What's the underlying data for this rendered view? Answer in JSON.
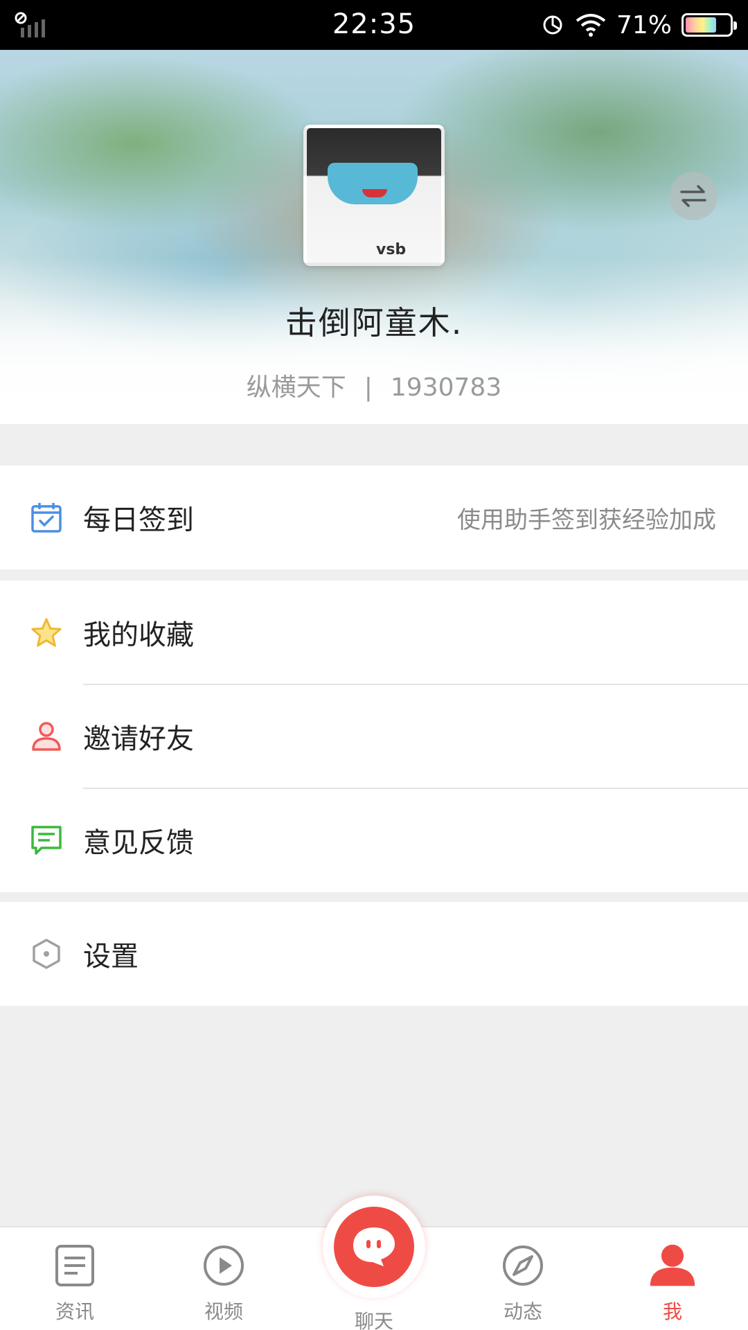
{
  "status_bar": {
    "time": "22:35",
    "battery_percent": "71%",
    "battery_level": 0.71
  },
  "profile": {
    "avatar_tag": "vsb",
    "username": "击倒阿童木.",
    "server": "纵横天下",
    "separator": "|",
    "user_id": "1930783"
  },
  "menu": {
    "checkin": {
      "label": "每日签到",
      "hint": "使用助手签到获经验加成",
      "icon": "calendar-check-icon",
      "color": "#4a90e2"
    },
    "favorites": {
      "label": "我的收藏",
      "icon": "star-icon",
      "color": "#f5c242"
    },
    "invite": {
      "label": "邀请好友",
      "icon": "person-icon",
      "color": "#ef5b57"
    },
    "feedback": {
      "label": "意见反馈",
      "icon": "message-icon",
      "color": "#3cb93c"
    },
    "settings": {
      "label": "设置",
      "icon": "hexagon-gear-icon",
      "color": "#9a9a9a"
    }
  },
  "bottom_nav": {
    "items": [
      {
        "label": "资讯",
        "icon": "news-icon"
      },
      {
        "label": "视频",
        "icon": "play-icon"
      },
      {
        "label": "聊天",
        "icon": "chat-bubble-icon"
      },
      {
        "label": "动态",
        "icon": "compass-icon"
      },
      {
        "label": "我",
        "icon": "user-icon",
        "active": true
      }
    ],
    "active_color": "#ef4b45",
    "inactive_color": "#8a8a8a"
  }
}
